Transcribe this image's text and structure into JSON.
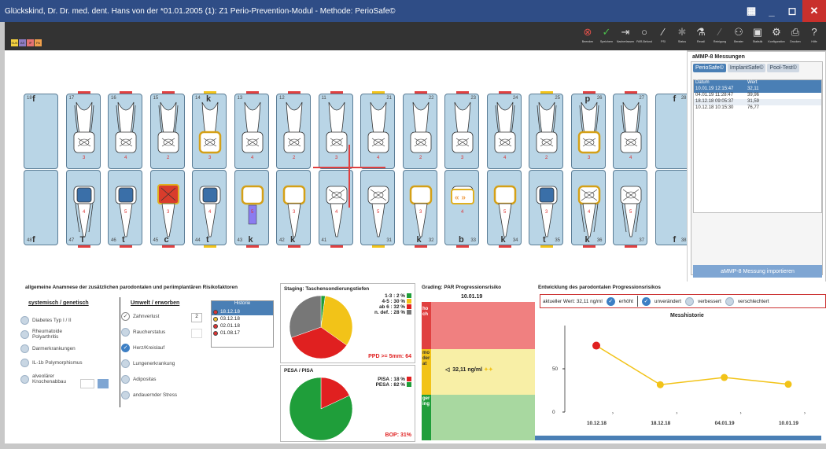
{
  "window": {
    "title": "Glückskind, Dr. Dr. med. dent. Hans von der *01.01.2005 (1): Z1 Perio-Prevention-Modul - Methode: PerioSafe©",
    "controls": [
      "▦",
      "_",
      "◻",
      "✕"
    ]
  },
  "tabs": [
    "SUK",
    "AS",
    "IP",
    "PA"
  ],
  "toolbar": [
    {
      "icon": "⊗",
      "label": "Beenden",
      "color": "#e0504a"
    },
    {
      "icon": "✓",
      "label": "Speichern",
      "color": "#4bbf4b"
    },
    {
      "icon": "⇥",
      "label": "Nacherfassen",
      "color": "#ddd"
    },
    {
      "icon": "○",
      "label": "PAR-Befund",
      "color": "#ddd"
    },
    {
      "icon": "∕",
      "label": "PSI",
      "color": "#ddd"
    },
    {
      "icon": "✱",
      "label": "Status",
      "color": "#777"
    },
    {
      "icon": "⚗",
      "label": "Recall",
      "color": "#ddd"
    },
    {
      "icon": "∕",
      "label": "Reinigung",
      "color": "#777"
    },
    {
      "icon": "⚇",
      "label": "Berater",
      "color": "#ddd"
    },
    {
      "icon": "▣",
      "label": "Statistik",
      "color": "#ddd"
    },
    {
      "icon": "⚙",
      "label": "Konfiguration",
      "color": "#ddd"
    },
    {
      "icon": "⎙",
      "label": "Drucken",
      "color": "#ddd"
    },
    {
      "icon": "?",
      "label": "Hilfe",
      "color": "#ddd"
    }
  ],
  "upper_teeth": [
    {
      "num": "18",
      "label": "f",
      "kind": "missing"
    },
    {
      "num": "17",
      "label": "",
      "kind": "molar"
    },
    {
      "num": "16",
      "label": "",
      "kind": "molar"
    },
    {
      "num": "15",
      "label": "",
      "kind": "premolar"
    },
    {
      "num": "14",
      "label": "k",
      "kind": "crown"
    },
    {
      "num": "13",
      "label": "",
      "kind": "canine"
    },
    {
      "num": "12",
      "label": "",
      "kind": "incisor"
    },
    {
      "num": "11",
      "label": "",
      "kind": "incisor"
    },
    {
      "num": "21",
      "label": "",
      "kind": "incisor"
    },
    {
      "num": "22",
      "label": "",
      "kind": "incisor"
    },
    {
      "num": "23",
      "label": "",
      "kind": "canine"
    },
    {
      "num": "24",
      "label": "",
      "kind": "premolar"
    },
    {
      "num": "25",
      "label": "",
      "kind": "premolar"
    },
    {
      "num": "26",
      "label": "p",
      "kind": "molarcrown"
    },
    {
      "num": "27",
      "label": "",
      "kind": "molar"
    },
    {
      "num": "28",
      "label": "f",
      "kind": "missing"
    }
  ],
  "lower_teeth": [
    {
      "num": "48",
      "label": "f",
      "kind": "missing"
    },
    {
      "num": "47",
      "label": "T",
      "kind": "implant"
    },
    {
      "num": "46",
      "label": "t",
      "kind": "implant2"
    },
    {
      "num": "45",
      "label": "c",
      "kind": "redcrown"
    },
    {
      "num": "44",
      "label": "t",
      "kind": "implant3"
    },
    {
      "num": "43",
      "label": "k",
      "kind": "screw"
    },
    {
      "num": "42",
      "label": "k",
      "kind": "crownlow"
    },
    {
      "num": "41",
      "label": "",
      "kind": "lowincisor"
    },
    {
      "num": "31",
      "label": "",
      "kind": "lowincisor"
    },
    {
      "num": "32",
      "label": "k",
      "kind": "crownlow"
    },
    {
      "num": "33",
      "label": "b",
      "kind": "bridge"
    },
    {
      "num": "34",
      "label": "k",
      "kind": "crownlow"
    },
    {
      "num": "35",
      "label": "t",
      "kind": "implant2"
    },
    {
      "num": "36",
      "label": "k",
      "kind": "crownmolar"
    },
    {
      "num": "37",
      "label": "",
      "kind": "molarlow"
    },
    {
      "num": "38",
      "label": "f",
      "kind": "missing"
    }
  ],
  "ammp": {
    "title": "aMMP-8 Messungen",
    "tabs": [
      "PerioSafe©",
      "ImplantSafe©",
      "Pool-Test©"
    ],
    "cols": [
      "Datum",
      "Wert"
    ],
    "rows": [
      [
        "10.01.19 12:15:47",
        "32,11"
      ],
      [
        "04.01.19 11:28:47",
        "39,96"
      ],
      [
        "18.12.18 09:05:37",
        "31,59"
      ],
      [
        "10.12.18 10:15:30",
        "76,77"
      ]
    ],
    "import": "aMMP-8 Messung importieren"
  },
  "anamnese": {
    "title": "allgemeine Anamnese der zusätzlichen parodontalen und periimplantären Risikofaktoren",
    "sys_title": "systemisch / genetisch",
    "sys_items": [
      "Diabetes Typ I / II",
      "Rheumatoide Polyarthritis",
      "Darmerkrankungen",
      "IL-1b Polymorphismus",
      "alveolärer Knochenabbau"
    ],
    "env_title": "Umwelt / erworben",
    "env_items": [
      {
        "l": "Zahnverlust",
        "s": "gray"
      },
      {
        "l": "Raucherstatus",
        "s": ""
      },
      {
        "l": "Herz/Kreislauf",
        "s": "on"
      },
      {
        "l": "Lungenerkrankung",
        "s": ""
      },
      {
        "l": "Adipositas",
        "s": ""
      },
      {
        "l": "andauernder Stress",
        "s": ""
      }
    ],
    "zahnverlust": "2",
    "hist_title": "Historie",
    "hist": [
      {
        "d": "18.12.18",
        "c": "r",
        "sel": true
      },
      {
        "d": "03.12.18",
        "c": "y",
        "sel": false
      },
      {
        "d": "02.01.18",
        "c": "r",
        "sel": false
      },
      {
        "d": "01.08.17",
        "c": "r",
        "sel": false
      }
    ]
  },
  "staging": {
    "title": "Staging: Taschensondierungstiefen",
    "legend": [
      "1-3 : 2 %",
      "4-5 : 30 %",
      "ab 6 : 32 %",
      "n. def. : 28 %"
    ],
    "colors": [
      "#1f9e3a",
      "#f2c318",
      "#e02020",
      "#777777"
    ],
    "values": [
      2,
      30,
      32,
      28
    ],
    "ppd": "PPD >= 5mm: 64"
  },
  "pesa": {
    "title": "PESA / PISA",
    "legend": [
      "PISA : 18 %",
      "PESA : 82 %"
    ],
    "colors": [
      "#e02020",
      "#1f9e3a"
    ],
    "values": [
      18,
      82
    ],
    "bop": "BOP: 31%"
  },
  "grading": {
    "title": "Grading: PAR Progressionsrisiko",
    "date": "10.01.19",
    "hoch": "hoch",
    "moderat": "moderat",
    "gering": "gering",
    "value": "32,11 ng/ml"
  },
  "progress": {
    "title": "Entwicklung des parodontalen Progressionsrisikos",
    "current": "aktueller Wert: 32,11 ng/ml",
    "opts": [
      "erhöht",
      "unverändert",
      "verbessert",
      "verschlechtert"
    ],
    "chart_title": "Messhistorie",
    "ytick": [
      "50",
      "0"
    ]
  },
  "chart_data": {
    "type": "line",
    "title": "Messhistorie",
    "categories": [
      "10.12.18",
      "18.12.18",
      "04.01.19",
      "10.01.19"
    ],
    "values": [
      76.77,
      31.59,
      39.96,
      32.11
    ],
    "ylim": [
      0,
      100
    ],
    "yticks": [
      0,
      50
    ],
    "series_color": "#f2c318",
    "first_point_color": "#e02020"
  }
}
